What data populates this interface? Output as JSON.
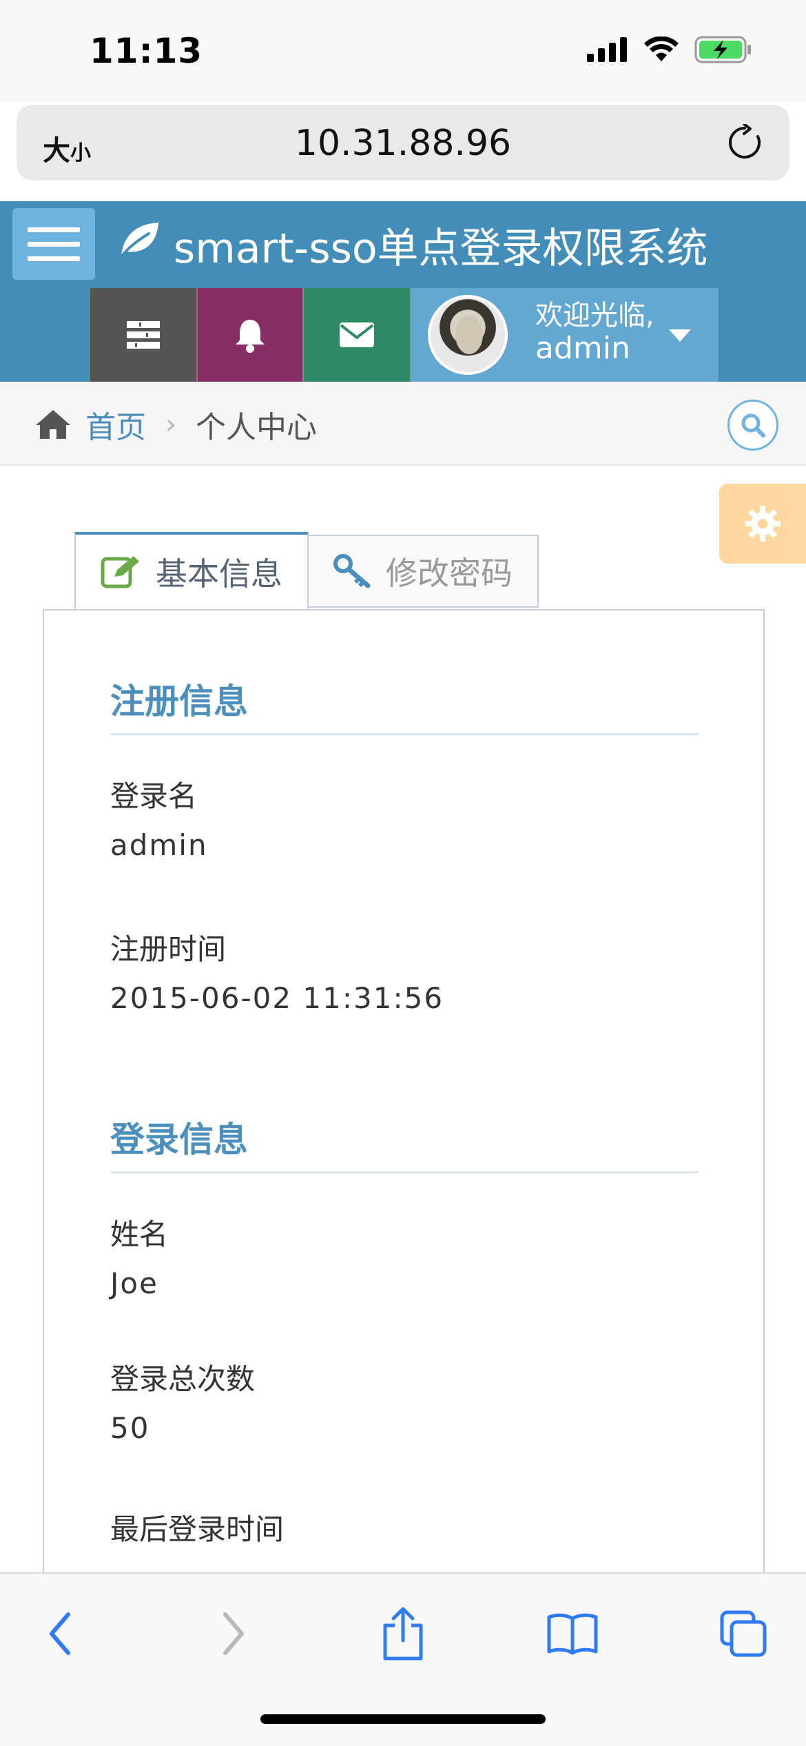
{
  "status_bar": {
    "time": "11:13"
  },
  "browser": {
    "text_size_label_big": "大",
    "text_size_label_small": "小",
    "url": "10.31.88.96"
  },
  "header": {
    "brand_title": "smart-sso单点登录权限系统"
  },
  "navbar": {
    "welcome": "欢迎光临,",
    "username": "admin"
  },
  "breadcrumb": {
    "home": "首页",
    "separator": "›",
    "current": "个人中心"
  },
  "tabs": [
    {
      "label": "基本信息",
      "active": true,
      "icon": "edit-icon"
    },
    {
      "label": "修改密码",
      "active": false,
      "icon": "key-icon"
    }
  ],
  "sections": {
    "register": {
      "title": "注册信息",
      "login_name_label": "登录名",
      "login_name_value": "admin",
      "register_time_label": "注册时间",
      "register_time_value": "2015-06-02 11:31:56"
    },
    "login": {
      "title": "登录信息",
      "name_label": "姓名",
      "name_value": "Joe",
      "login_count_label": "登录总次数",
      "login_count_value": "50",
      "last_login_label": "最后登录时间"
    }
  },
  "colors": {
    "header_bg": "#438eb9",
    "accent": "#4c8fbd",
    "tasks_bg": "#555555",
    "notifications_bg": "#892e65",
    "messages_bg": "#2e8965",
    "user_bg": "#62a8d1",
    "settings_bg": "#ffb752"
  }
}
